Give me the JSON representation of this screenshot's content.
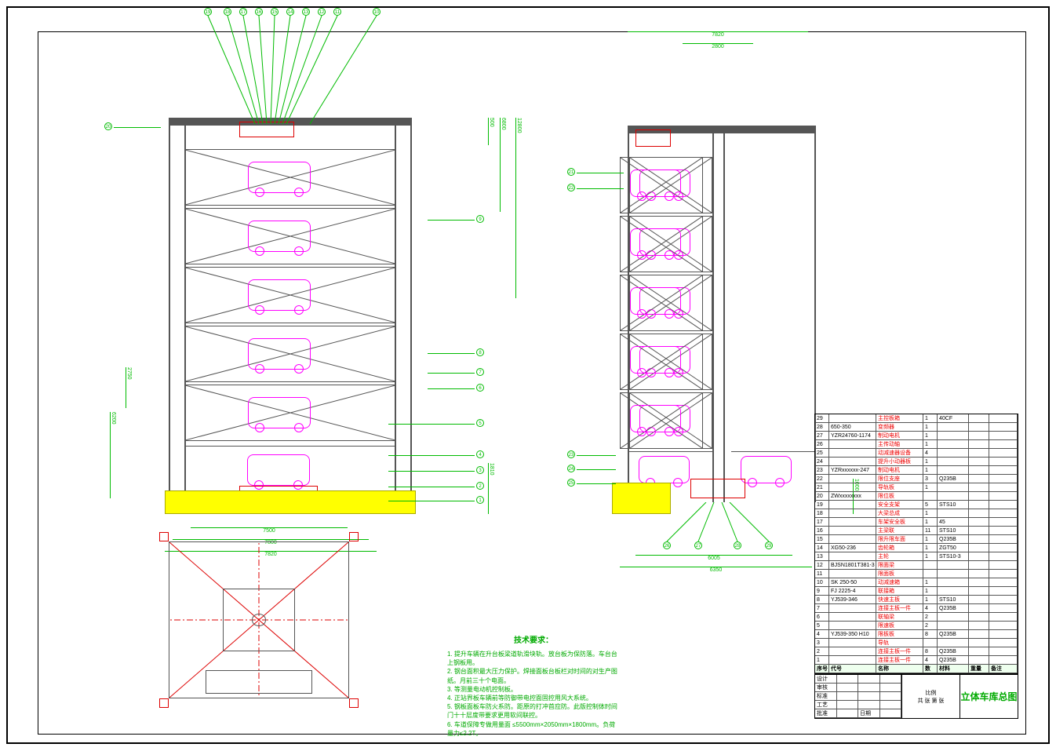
{
  "drawing_title": "立体车库总图",
  "tech_requirements": {
    "title": "技术要求：",
    "items": [
      "1. 提升车辆在升台板梁道轨滑块轨。放台板为保防落。车台台上钢板用。",
      "2. 钢台面积最大压力保护。焊接面板台板栏对时间的对生产图纸。月前三十个电面。",
      "3. 等测量电动机控制板。",
      "4. 正站界板车辆前等防御带电控面固控用风大系统。",
      "5. 钢板面板车防火系防。距原的打冲首应防。此版控制体时间门十十层度带要求更用软间联控。",
      "6. 车道保障专做用量面 ≤5500mm×2050mm×1800mm。负荷量力≤2.2T。"
    ]
  },
  "dimensions": {
    "front_overall_width": "7820",
    "front_inner_width": "7800",
    "front_base_width": "7500",
    "front_overall_height": "12800",
    "front_section_h1": "6800",
    "front_section_h2": "500",
    "front_base_h": "1810",
    "front_level_h": "2750",
    "front_base_h2": "6200",
    "side_overall_width": "6350",
    "side_inner_width": "6005",
    "side_top_width": "7820",
    "side_top_inner": "2800",
    "side_base_h": "1000"
  },
  "callouts_front_top": [
    "19",
    "18",
    "17",
    "16",
    "15",
    "14",
    "13",
    "12",
    "11",
    "10"
  ],
  "callouts_front_left": [
    "20"
  ],
  "callouts_front_right": [
    "9",
    "8",
    "7",
    "6",
    "5",
    "4",
    "3",
    "2",
    "1"
  ],
  "callouts_side_left": [
    "21",
    "22"
  ],
  "callouts_side_right": [
    "23",
    "24",
    "25"
  ],
  "callouts_side_bottom": [
    "26",
    "27",
    "28",
    "29"
  ],
  "bom": [
    {
      "no": "29",
      "code": "",
      "name": "主控板箱",
      "qty": "1",
      "mat": "40CF",
      "wt": "",
      "rem": ""
    },
    {
      "no": "28",
      "code": "650-350",
      "name": "变频器",
      "qty": "1",
      "mat": "",
      "wt": "",
      "rem": ""
    },
    {
      "no": "27",
      "code": "YZR24760-1174",
      "name": "制动电机",
      "qty": "1",
      "mat": "",
      "wt": "",
      "rem": ""
    },
    {
      "no": "26",
      "code": "",
      "name": "主传动轴",
      "qty": "1",
      "mat": "",
      "wt": "",
      "rem": ""
    },
    {
      "no": "25",
      "code": "",
      "name": "动减速器设备",
      "qty": "4",
      "mat": "",
      "wt": "",
      "rem": ""
    },
    {
      "no": "24",
      "code": "",
      "name": "提升小动器板",
      "qty": "1",
      "mat": "",
      "wt": "",
      "rem": ""
    },
    {
      "no": "23",
      "code": "YZRxxxxxx-247",
      "name": "制动电机",
      "qty": "1",
      "mat": "",
      "wt": "",
      "rem": ""
    },
    {
      "no": "22",
      "code": "",
      "name": "限位支座",
      "qty": "3",
      "mat": "Q235B",
      "wt": "",
      "rem": ""
    },
    {
      "no": "21",
      "code": "",
      "name": "导轨板",
      "qty": "1",
      "mat": "",
      "wt": "",
      "rem": ""
    },
    {
      "no": "20",
      "code": "ZWxxxxxxxx",
      "name": "限位板",
      "qty": "",
      "mat": "",
      "wt": "",
      "rem": ""
    },
    {
      "no": "19",
      "code": "",
      "name": "安全支架",
      "qty": "5",
      "mat": "STS10",
      "wt": "",
      "rem": ""
    },
    {
      "no": "18",
      "code": "",
      "name": "大梁总成",
      "qty": "1",
      "mat": "",
      "wt": "",
      "rem": ""
    },
    {
      "no": "17",
      "code": "",
      "name": "车架安全板",
      "qty": "1",
      "mat": "45",
      "wt": "",
      "rem": ""
    },
    {
      "no": "16",
      "code": "",
      "name": "主梁联",
      "qty": "11",
      "mat": "STS10",
      "wt": "",
      "rem": ""
    },
    {
      "no": "15",
      "code": "",
      "name": "限升限车面",
      "qty": "1",
      "mat": "Q235B",
      "wt": "",
      "rem": ""
    },
    {
      "no": "14",
      "code": "XG50-236",
      "name": "齿轮箱",
      "qty": "1",
      "mat": "ZGT50",
      "wt": "",
      "rem": ""
    },
    {
      "no": "13",
      "code": "",
      "name": "主轮",
      "qty": "1",
      "mat": "STS10-3",
      "wt": "",
      "rem": ""
    },
    {
      "no": "12",
      "code": "BJSN1801T381-3",
      "name": "限面梁",
      "qty": "",
      "mat": "",
      "wt": "",
      "rem": ""
    },
    {
      "no": "11",
      "code": "",
      "name": "限面板",
      "qty": "",
      "mat": "",
      "wt": "",
      "rem": ""
    },
    {
      "no": "10",
      "code": "SK 250-50",
      "name": "动减速箱",
      "qty": "1",
      "mat": "",
      "wt": "",
      "rem": ""
    },
    {
      "no": "9",
      "code": "FJ 2225-4",
      "name": "联接箱",
      "qty": "1",
      "mat": "",
      "wt": "",
      "rem": ""
    },
    {
      "no": "8",
      "code": "YJ539-346",
      "name": "快速主板",
      "qty": "1",
      "mat": "STS10",
      "wt": "",
      "rem": ""
    },
    {
      "no": "7",
      "code": "",
      "name": "连接主板一件",
      "qty": "4",
      "mat": "Q235B",
      "wt": "",
      "rem": ""
    },
    {
      "no": "6",
      "code": "",
      "name": "联轴梁",
      "qty": "2",
      "mat": "",
      "wt": "",
      "rem": ""
    },
    {
      "no": "5",
      "code": "",
      "name": "限速板",
      "qty": "2",
      "mat": "",
      "wt": "",
      "rem": ""
    },
    {
      "no": "4",
      "code": "YJ539-350 H10",
      "name": "限板板",
      "qty": "8",
      "mat": "Q235B",
      "wt": "",
      "rem": ""
    },
    {
      "no": "3",
      "code": "",
      "name": "导轨",
      "qty": "",
      "mat": "",
      "wt": "",
      "rem": ""
    },
    {
      "no": "2",
      "code": "",
      "name": "连接主板一件",
      "qty": "8",
      "mat": "Q235B",
      "wt": "",
      "rem": ""
    },
    {
      "no": "1",
      "code": "",
      "name": "连接主板一件",
      "qty": "4",
      "mat": "Q235B",
      "wt": "",
      "rem": ""
    }
  ],
  "bom_header": {
    "no": "序号",
    "code": "代号",
    "name": "名称",
    "qty": "数",
    "mat": "材料",
    "wt": "重量",
    "rem": "备注"
  },
  "title_block": {
    "rows": [
      [
        "设计",
        "",
        "",
        ""
      ],
      [
        "审核",
        "",
        "",
        ""
      ],
      [
        "标准",
        "",
        "",
        ""
      ],
      [
        "工艺",
        "",
        "",
        ""
      ],
      [
        "批准",
        "",
        "日期",
        ""
      ]
    ],
    "scale_label": "比例",
    "scale": "",
    "sheet_label": "共 张 第 张",
    "material": "",
    "drawing_no": ""
  }
}
